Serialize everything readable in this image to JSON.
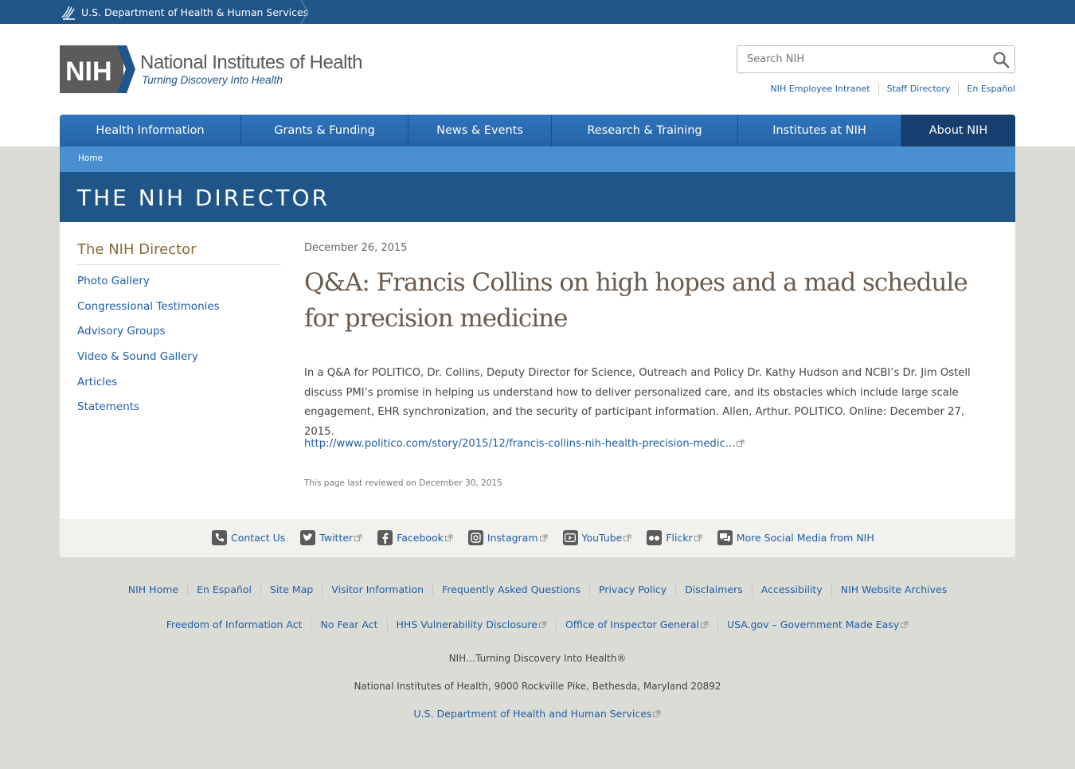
{
  "hhs_bar": {
    "text": "U.S. Department of Health & Human Services"
  },
  "logo": {
    "mark": "NIH",
    "title": "National Institutes of Health",
    "tagline": "Turning Discovery Into Health"
  },
  "search": {
    "placeholder": "Search NIH"
  },
  "utility_links": [
    "NIH Employee Intranet",
    "Staff Directory",
    "En Español"
  ],
  "nav": [
    {
      "label": "Health Information"
    },
    {
      "label": "Grants & Funding"
    },
    {
      "label": "News & Events"
    },
    {
      "label": "Research & Training"
    },
    {
      "label": "Institutes at NIH"
    },
    {
      "label": "About NIH"
    }
  ],
  "breadcrumb": {
    "home": "Home"
  },
  "banner": {
    "title": "THE NIH DIRECTOR"
  },
  "sidebar": {
    "title": "The NIH Director",
    "items": [
      "Photo Gallery",
      "Congressional Testimonies",
      "Advisory Groups",
      "Video & Sound Gallery",
      "Articles",
      "Statements"
    ]
  },
  "article": {
    "date": "December 26, 2015",
    "headline": "Q&A: Francis Collins on high hopes and a mad schedule for precision medicine",
    "body": "In a Q&A for POLITICO, Dr. Collins, Deputy Director for Science, Outreach and Policy Dr. Kathy Hudson and NCBI’s Dr. Jim Ostell discuss PMI’s promise in helping us understand how to deliver personalized care, and its obstacles which include large scale engagement, EHR synchronization, and the security of participant information. Allen, Arthur. POLITICO. Online: December 27, 2015.",
    "link": "http://www.politico.com/story/2015/12/francis-collins-nih-health-precision-medic...",
    "reviewed": "This page last reviewed on December 30, 2015"
  },
  "social": [
    "Contact Us",
    "Twitter",
    "Facebook",
    "Instagram",
    "YouTube",
    "Flickr",
    "More Social Media from NIH"
  ],
  "footer": {
    "row1": [
      "NIH Home",
      "En Español",
      "Site Map",
      "Visitor Information",
      "Frequently Asked Questions",
      "Privacy Policy",
      "Disclaimers",
      "Accessibility",
      "NIH Website Archives"
    ],
    "row2": [
      "Freedom of Information Act",
      "No Fear Act",
      "HHS Vulnerability Disclosure",
      "Office of Inspector General",
      "USA.gov – Government Made Easy"
    ],
    "tagline": "NIH…Turning Discovery Into Health®",
    "address": "National Institutes of Health, 9000 Rockville Pike, Bethesda, Maryland 20892",
    "hhs_link": "U.S. Department of Health and Human Services"
  },
  "colors": {
    "hhs_blue": "#20558a",
    "nav_blue": "#2563a6",
    "nav_active": "#163f70",
    "breadcrumb_blue": "#4a8fd0",
    "link": "#1f5da8",
    "sidebar_title": "#8a6b36"
  }
}
